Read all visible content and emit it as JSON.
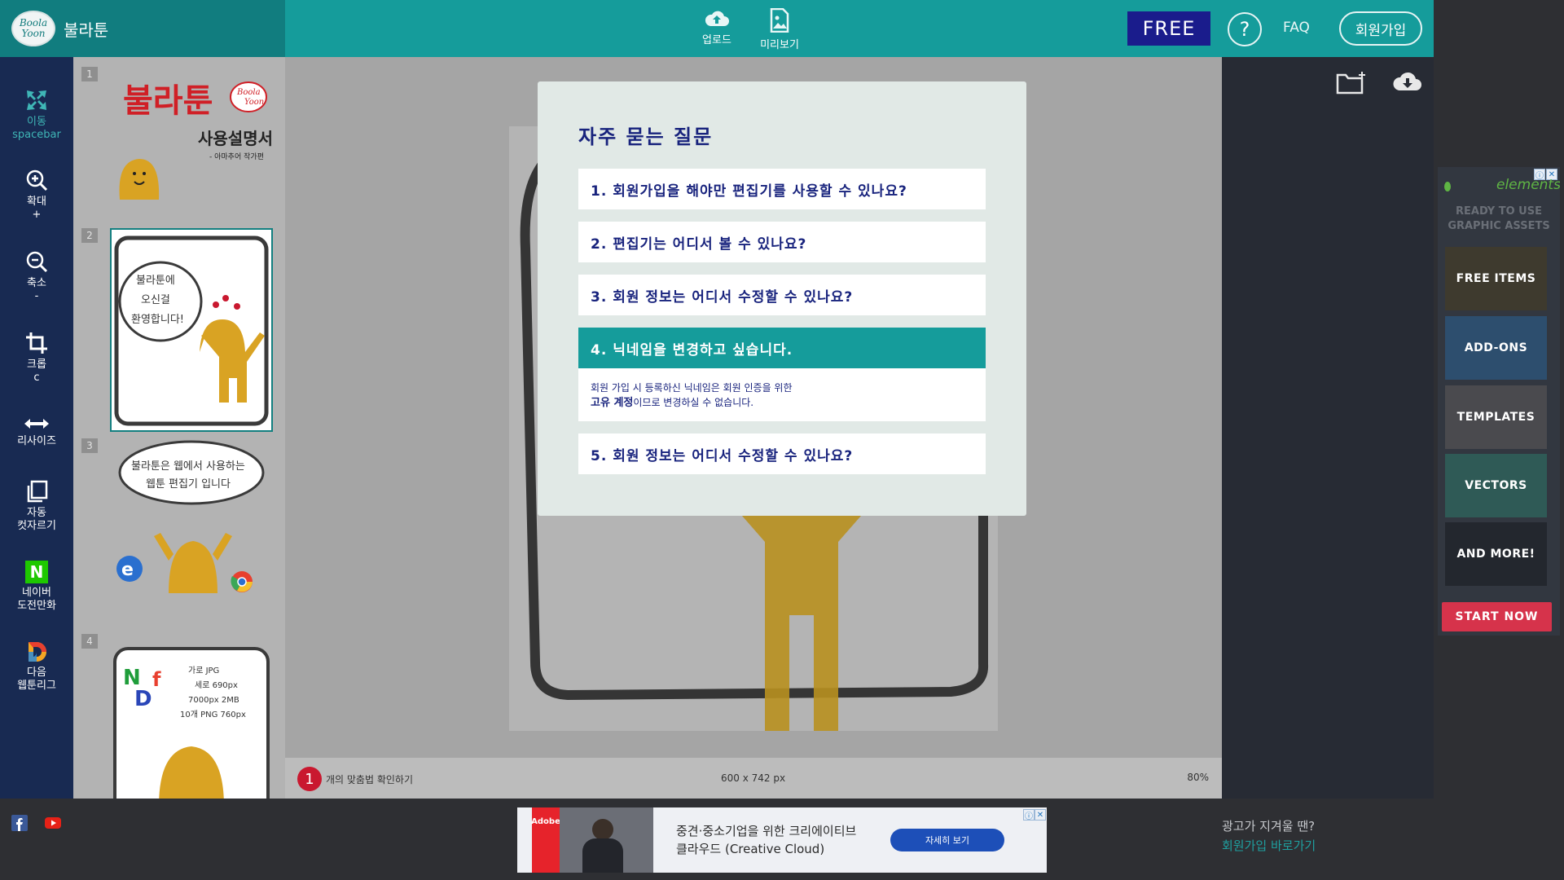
{
  "header": {
    "logo_text": [
      "Boola",
      "Yoon"
    ],
    "app_name": "불라툰",
    "upload_label": "업로드",
    "preview_label": "미리보기",
    "free_label": "FREE",
    "help_label": "?",
    "faq_label": "FAQ",
    "signup_label": "회원가입"
  },
  "toolbar": {
    "move": [
      "이동",
      "spacebar"
    ],
    "zoom_in": [
      "확대",
      "+"
    ],
    "zoom_out": [
      "축소",
      "-"
    ],
    "crop": [
      "크롭",
      "c"
    ],
    "resize": [
      "리사이즈"
    ],
    "auto_cut": [
      "자동",
      "컷자르기"
    ],
    "naver": [
      "네이버",
      "도전만화"
    ],
    "daum": [
      "다음",
      "웹툰리그"
    ],
    "naver_letter": "N",
    "daum_letter": "D"
  },
  "thumbnails": {
    "numbers": [
      "1",
      "2",
      "3",
      "4"
    ],
    "t1": {
      "title": "불라툰",
      "subtitle": "사용설명서",
      "author": "- 아마추어 작가편",
      "logo": [
        "Boola",
        "Yoon"
      ]
    },
    "t2": {
      "bubble": [
        "불라툰에",
        "오신걸",
        "환영합니다!"
      ]
    },
    "t3": {
      "bubble": [
        "불라툰은 웹에서 사용하는",
        "웹툰 편집기 입니다"
      ]
    },
    "t4": {
      "letters": "NDF",
      "notes": [
        "가로 JPG",
        "세로 690px",
        "7000px 2MB",
        "10개 PNG 760px"
      ]
    }
  },
  "status": {
    "badge": "1",
    "left_text": "개의 맞춤법 확인하기",
    "size_text": "600 x 742 px",
    "zoom_text": "80%"
  },
  "modal": {
    "title": "자주 묻는 질문",
    "items": [
      "1. 회원가입을 해야만 편집기를 사용할 수 있나요?",
      "2. 편집기는 어디서 볼 수 있나요?",
      "3. 회원 정보는 어디서 수정할 수 있나요?",
      "4. 닉네임을 변경하고 싶습니다.",
      "5. 회원 정보는 어디서 수정할 수 있나요?"
    ],
    "answer_line1": "회원 가입 시 등록하신 닉네임은 회원 인증을 위한",
    "answer_bold": "고유 계정",
    "answer_rest": "이므로 변경하실 수 없습니다."
  },
  "right_ad": {
    "logo": "elements",
    "tagline": [
      "READY TO USE",
      "GRAPHIC ASSETS"
    ],
    "tiles": [
      "FREE ITEMS",
      "ADD-ONS",
      "TEMPLATES",
      "VECTORS",
      "AND MORE!"
    ],
    "cta": "START NOW"
  },
  "bottom_ad": {
    "brand": "Adobe",
    "line1": "중견·중소기업을 위한 크리에이티브",
    "line2": "클라우드 (Creative Cloud)",
    "cta": "자세히 보기"
  },
  "ad_notice": {
    "line1": "광고가 지겨울 땐?",
    "line2": "회원가입 바로가기"
  },
  "colors": {
    "header": "#159c9b",
    "toolbar": "#182a52",
    "accent": "#159c9b",
    "navy_text": "#18237d",
    "free_button": "#1a1c8c",
    "character": "#d9a323"
  }
}
